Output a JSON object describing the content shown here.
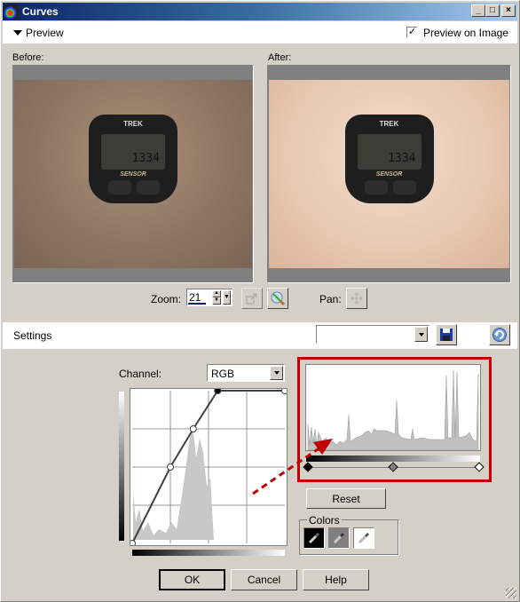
{
  "window": {
    "title": "Curves",
    "controls": {
      "minimize": "_",
      "maximize": "□",
      "close": "×"
    }
  },
  "preview": {
    "toggle_label": "Preview",
    "preview_on_image_label": "Preview on Image",
    "preview_on_image_checked": true,
    "checkmark": "✓",
    "before_label": "Before:",
    "after_label": "After:",
    "device_brand": "TREK",
    "device_digits": "1334",
    "device_sensor": "SENSOR"
  },
  "zoom": {
    "label": "Zoom:",
    "value": "21",
    "pan_label": "Pan:",
    "icons": [
      "zoom-to-fit-icon",
      "zoom-disable-icon",
      "pan-move-icon"
    ]
  },
  "settings": {
    "label": "Settings",
    "preset_value": "",
    "icons": [
      "save-preset-icon",
      "reset-defaults-icon"
    ]
  },
  "curves": {
    "channel_label": "Channel:",
    "channel_value": "RGB",
    "points": [
      [
        0,
        0
      ],
      [
        0.25,
        0.5
      ],
      [
        0.4,
        0.75
      ],
      [
        0.56,
        1.0
      ],
      [
        1.0,
        1.0
      ]
    ],
    "grid_divisions": 4
  },
  "histogram": {
    "slider_markers": [
      "black-point",
      "midtone",
      "white-point"
    ],
    "marker_positions": [
      0,
      0.5,
      1.0
    ]
  },
  "buttons": {
    "reset": "Reset",
    "ok": "OK",
    "cancel": "Cancel",
    "help": "Help"
  },
  "colors": {
    "label": "Colors",
    "eyedroppers": [
      "black-eyedropper",
      "gray-eyedropper",
      "white-eyedropper"
    ],
    "accent_highlight": "#c00000"
  }
}
